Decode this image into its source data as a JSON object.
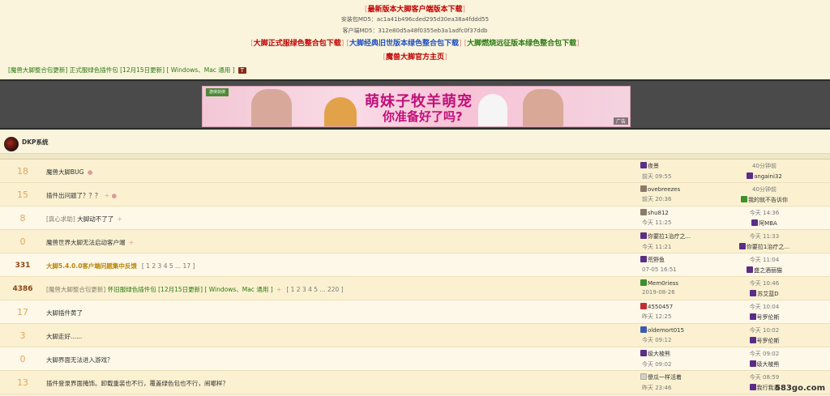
{
  "header": {
    "latest_download": "最新版本大脚客户端版本下载",
    "md5_install": "安装包MD5：ac1a41b496cded295d30ea38a4fddd55",
    "md5_client": "客户端MD5：312e80d5a48f0355eb3a1adfc0f37ddb",
    "links": [
      "大脚正式服绿色整合包下载",
      "大脚经典旧世版本绿色整合包下载",
      "大脚燃烧远征版本绿色整合包下载"
    ],
    "homepage": "魔兽大脚官方主页"
  },
  "category_line": "[魔兽大脚整合包更新] 正式服绿色插件包 [12月15日更新] [ Windows、Mac 通用 ]",
  "category_badge": "T",
  "banner": {
    "logo": "游侠剑侠",
    "line1": "萌妹子牧羊萌宠",
    "line2": "你准备好了吗?",
    "ad_label": "广告"
  },
  "forum": {
    "title": "DKP系统"
  },
  "colors": {
    "accent_red": "#c00000",
    "link_blue": "#2050c0",
    "link_green": "#2a7a10",
    "row_bg": "#fbf1d1"
  },
  "threads": [
    {
      "replies": "18",
      "title": "魔兽大脚BUG",
      "mark": "●",
      "author": "夜景",
      "author_icon": "purple",
      "date": "前天 09:55",
      "last_time": "40分钟前",
      "last_user": "angaini32",
      "last_icon": "purple",
      "alt": true
    },
    {
      "replies": "15",
      "title": "插件出问题了？？？",
      "mark": "+ ●",
      "author": "ovebreezes",
      "author_icon": "gray",
      "date": "前天 20:36",
      "last_time": "40分钟前",
      "last_user": "我的就不告诉你",
      "last_icon": "green",
      "alt": true
    },
    {
      "replies": "8",
      "cat": "[真心求助]",
      "title": "大脚动不了了",
      "mark": "+",
      "author": "shu812",
      "author_icon": "gray",
      "date": "今天 11:25",
      "last_time": "今天 14:36",
      "last_user": "阿MBA",
      "last_icon": "purple",
      "alt": false
    },
    {
      "replies": "0",
      "title": "魔兽世界大脚无法启动客户端",
      "mark": "+",
      "author": "你要拉1治疗之...",
      "author_icon": "purple",
      "date": "今天 11:21",
      "last_time": "今天 11:33",
      "last_user": "你要拉1治疗之...",
      "last_icon": "purple",
      "alt": true
    },
    {
      "replies": "331",
      "bold": true,
      "highlight": true,
      "title": "大脚5.4.0.0客户端问题集中反馈",
      "pages": "[ 1 2 3 4 5 ... 17 ]",
      "author": "荒野鱼",
      "author_icon": "purple",
      "date": "07-05 16:51",
      "last_time": "今天 11:04",
      "last_user": "盛之酒丽猫",
      "last_icon": "purple",
      "alt": false
    },
    {
      "replies": "4386",
      "bold": true,
      "cat": "[魔兽大脚整合包更新]",
      "green": "怀旧服绿色插件包 [12月15日更新] [ Windows、Mac 通用 ]",
      "mark": "+",
      "pages": "[ 1 2 3 4 5 ... 220 ]",
      "author": "Mem0riess",
      "author_icon": "green",
      "date": "2019-08-26",
      "last_time": "今天 10:46",
      "last_user": "苏艾蓝D",
      "last_icon": "purple",
      "alt": true
    },
    {
      "replies": "17",
      "title": "大脚插件黄了",
      "author": "4550457",
      "author_icon": "red",
      "date": "昨天 12:25",
      "last_time": "今天 10:04",
      "last_user": "号罗伦斯",
      "last_icon": "purple",
      "alt": false
    },
    {
      "replies": "3",
      "title": "大脚走好......",
      "author": "oldemort015",
      "author_icon": "blue",
      "date": "今天 09:12",
      "last_time": "今天 10:02",
      "last_user": "号罗伦斯",
      "last_icon": "purple",
      "alt": true
    },
    {
      "replies": "0",
      "title": "大脚界面无法进入游戏？",
      "author": "级大棱熊",
      "author_icon": "purple",
      "date": "今天 09:02",
      "last_time": "今天 09:02",
      "last_user": "级大棱熊",
      "last_icon": "purple",
      "alt": false
    },
    {
      "replies": "13",
      "title": "插件登录界面掩饰。卸载重装也不行，覆盖绿色包也不行，闹哪样？",
      "author": "傻瓜一样活着",
      "author_icon": "light",
      "date": "昨天 23:46",
      "last_time": "今天 08:59",
      "last_user": "我行我素",
      "last_icon": "purple",
      "alt": true
    }
  ],
  "watermark": {
    "brand": "583go",
    "tld": ".com"
  }
}
